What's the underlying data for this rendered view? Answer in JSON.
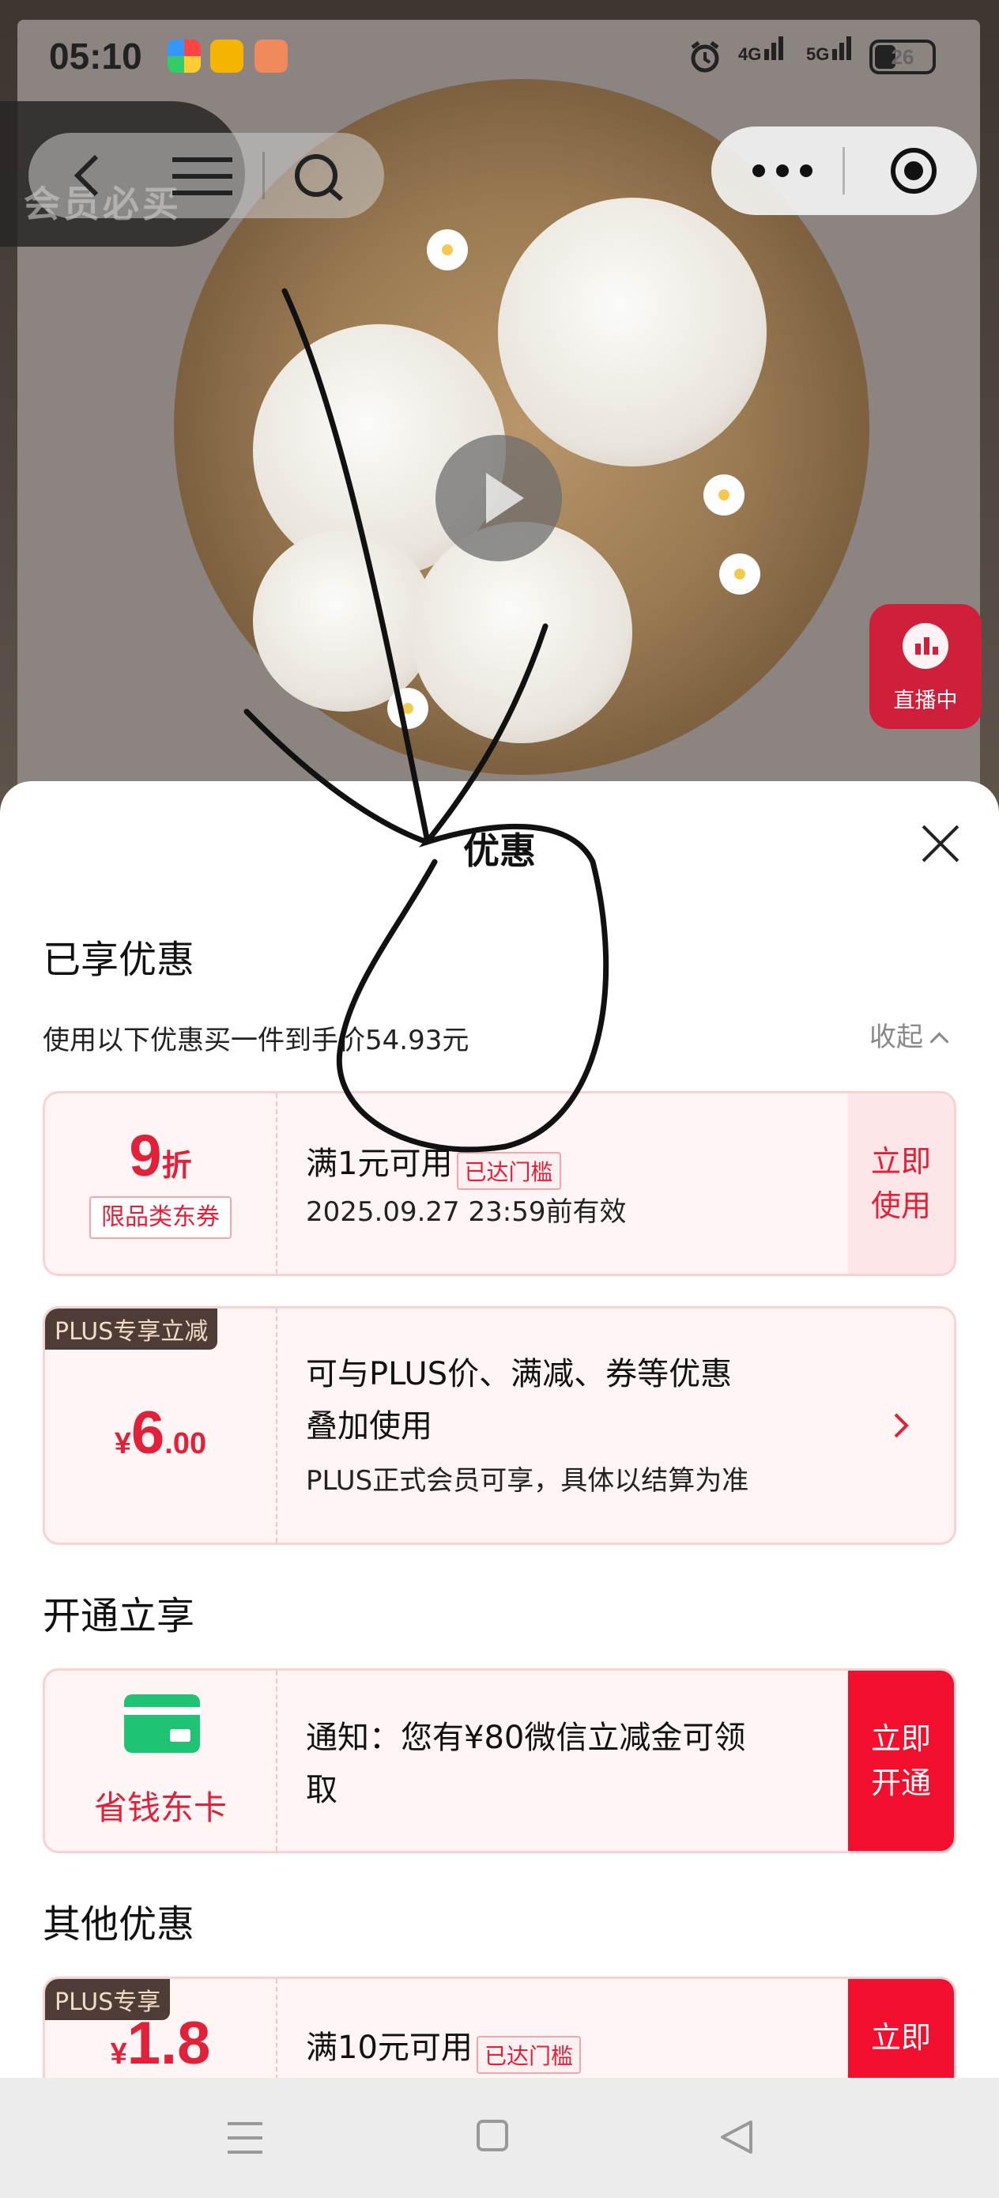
{
  "status_bar": {
    "time": "05:10",
    "net_4g": "4G",
    "net_5g": "5G",
    "battery": "26"
  },
  "media": {
    "member_badge": "会员必买",
    "live_label": "直播中"
  },
  "sheet": {
    "title": "优惠",
    "applied_section": "已享优惠",
    "applied_line": "使用以下优惠买一件到手价54.93元",
    "collapse_label": "收起",
    "coupon_discount": {
      "value": "9",
      "unit": "折",
      "type": "限品类东券",
      "condition": "满1元可用",
      "tag": "已达门槛",
      "validity": "2025.09.27 23:59前有效",
      "action": "立即使用"
    },
    "plus_discount": {
      "tag": "PLUS专享立减",
      "currency": "¥",
      "amount_int": "6",
      "amount_dec": ".00",
      "line1": "可与PLUS价、满减、券等优惠",
      "line2": "叠加使用",
      "note": "PLUS正式会员可享，具体以结算为准"
    },
    "open_section": "开通立享",
    "saver_card": {
      "name": "省钱东卡",
      "text1": "通知：您有¥80微信立减金可领",
      "text2": "取",
      "action": "立即开通"
    },
    "other_section": "其他优惠",
    "plus_coupon": {
      "tag": "PLUS专享",
      "currency": "¥",
      "amount": "1.8",
      "condition": "满10元可用",
      "threshold_tag": "已达门槛",
      "action": "立即"
    }
  },
  "colors": {
    "accent": "#e1203a",
    "accent_strong": "#f2102e",
    "card_bg": "#fff5f5",
    "plus_tag_bg": "#4e3d36",
    "green": "#1fc374"
  }
}
